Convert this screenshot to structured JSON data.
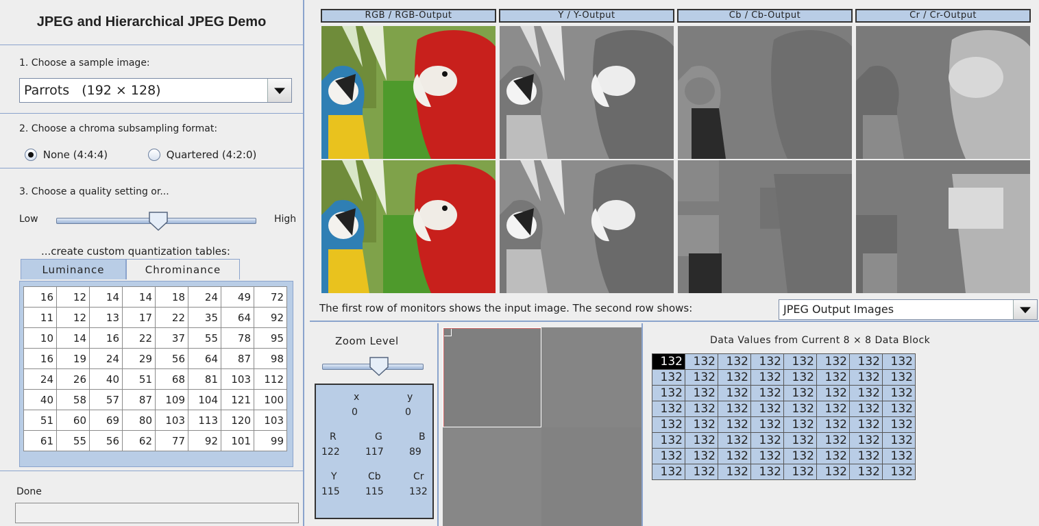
{
  "app": {
    "title": "JPEG and Hierarchical JPEG Demo"
  },
  "sample": {
    "label": "1. Choose a sample image:",
    "selected": "Parrots   (192 × 128)"
  },
  "chroma": {
    "label": "2. Choose a chroma subsampling format:",
    "options": [
      "None (4:4:4)",
      "Quartered (4:2:0)"
    ],
    "selected_index": 0
  },
  "quality": {
    "label": "3. Choose a quality setting or...",
    "low": "Low",
    "high": "High",
    "level_fraction": 0.5
  },
  "custom": {
    "label": "...create custom quantization tables:",
    "tabs": [
      "Luminance",
      "Chrominance"
    ],
    "active_tab": 0
  },
  "quant_table": [
    [
      "16",
      "12",
      "14",
      "14",
      "18",
      "24",
      "49",
      "72"
    ],
    [
      "11",
      "12",
      "13",
      "17",
      "22",
      "35",
      "64",
      "92"
    ],
    [
      "10",
      "14",
      "16",
      "22",
      "37",
      "55",
      "78",
      "95"
    ],
    [
      "16",
      "19",
      "24",
      "29",
      "56",
      "64",
      "87",
      "98"
    ],
    [
      "24",
      "26",
      "40",
      "51",
      "68",
      "81",
      "103",
      "112"
    ],
    [
      "40",
      "58",
      "57",
      "87",
      "109",
      "104",
      "121",
      "100"
    ],
    [
      "51",
      "60",
      "69",
      "80",
      "103",
      "113",
      "120",
      "103"
    ],
    [
      "61",
      "55",
      "56",
      "62",
      "77",
      "92",
      "101",
      "99"
    ]
  ],
  "status": {
    "text": "Done"
  },
  "monitors": {
    "captions": [
      "RGB / RGB-Output",
      "Y / Y-Output",
      "Cb / Cb-Output",
      "Cr / Cr-Output"
    ],
    "caption_text": "The first row of monitors shows the input image. The second row shows:",
    "second_row_selection": "JPEG Output Images"
  },
  "zoom": {
    "label": "Zoom Level",
    "level_fraction": 0.52
  },
  "pixel_info": {
    "x_label": "x",
    "y_label": "y",
    "x": "0",
    "y": "0",
    "R_label": "R",
    "G_label": "G",
    "B_label": "B",
    "R": "122",
    "G": "117",
    "B": "89",
    "Y_label": "Y",
    "Cb_label": "Cb",
    "Cr_label": "Cr",
    "Y": "115",
    "Cb": "115",
    "Cr": "132"
  },
  "data_values": {
    "title": "Data Values from Current 8 × 8 Data Block",
    "rows": [
      [
        "132",
        "132",
        "132",
        "132",
        "132",
        "132",
        "132",
        "132"
      ],
      [
        "132",
        "132",
        "132",
        "132",
        "132",
        "132",
        "132",
        "132"
      ],
      [
        "132",
        "132",
        "132",
        "132",
        "132",
        "132",
        "132",
        "132"
      ],
      [
        "132",
        "132",
        "132",
        "132",
        "132",
        "132",
        "132",
        "132"
      ],
      [
        "132",
        "132",
        "132",
        "132",
        "132",
        "132",
        "132",
        "132"
      ],
      [
        "132",
        "132",
        "132",
        "132",
        "132",
        "132",
        "132",
        "132"
      ],
      [
        "132",
        "132",
        "132",
        "132",
        "132",
        "132",
        "132",
        "132"
      ],
      [
        "132",
        "132",
        "132",
        "132",
        "132",
        "132",
        "132",
        "132"
      ]
    ]
  },
  "colors": {
    "accent_blue": "#b9cde6",
    "border_blue": "#8aa3cc",
    "parrot_red": "#c8201c",
    "leaf_green": "#4e9a2c",
    "macaw_yellow": "#e9c21e"
  }
}
